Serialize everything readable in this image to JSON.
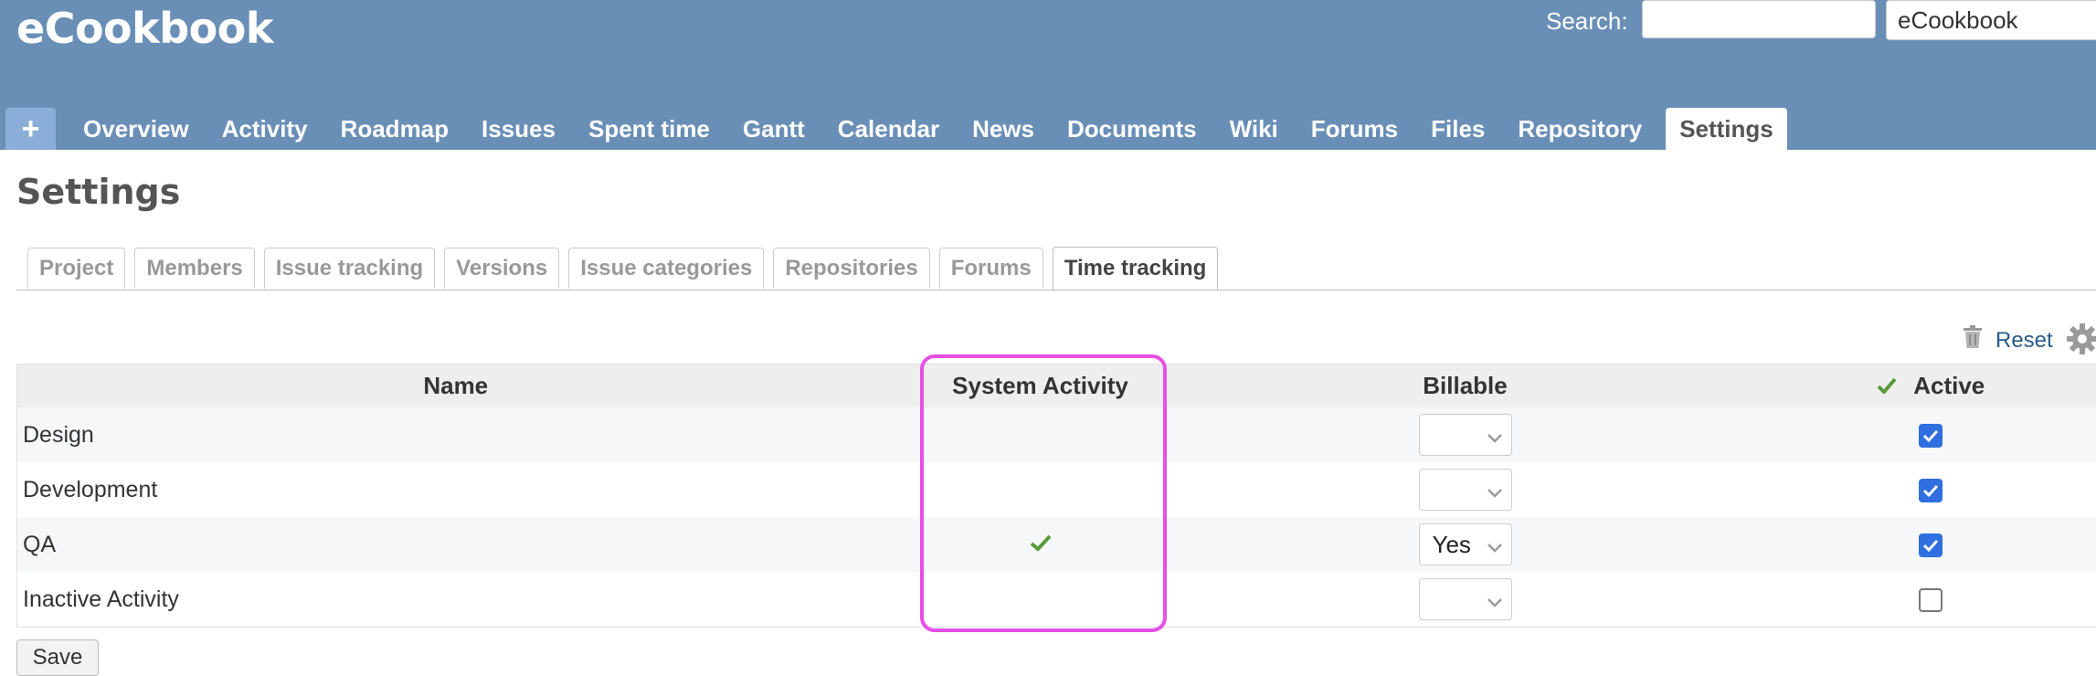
{
  "header": {
    "app_title": "eCookbook",
    "search_label": "Search:",
    "search_value": "",
    "project_select": "eCookbook"
  },
  "main_menu": {
    "plus_label": "+",
    "items": [
      {
        "label": "Overview"
      },
      {
        "label": "Activity"
      },
      {
        "label": "Roadmap"
      },
      {
        "label": "Issues"
      },
      {
        "label": "Spent time"
      },
      {
        "label": "Gantt"
      },
      {
        "label": "Calendar"
      },
      {
        "label": "News"
      },
      {
        "label": "Documents"
      },
      {
        "label": "Wiki"
      },
      {
        "label": "Forums"
      },
      {
        "label": "Files"
      },
      {
        "label": "Repository"
      },
      {
        "label": "Settings",
        "selected": true
      }
    ]
  },
  "page": {
    "title": "Settings"
  },
  "settings_tabs": [
    {
      "label": "Project"
    },
    {
      "label": "Members"
    },
    {
      "label": "Issue tracking"
    },
    {
      "label": "Versions"
    },
    {
      "label": "Issue categories"
    },
    {
      "label": "Repositories"
    },
    {
      "label": "Forums"
    },
    {
      "label": "Time tracking",
      "selected": true
    }
  ],
  "actions": {
    "reset_label": "Reset"
  },
  "table": {
    "headers": {
      "name": "Name",
      "system_activity": "System Activity",
      "billable": "Billable",
      "active": "Active"
    },
    "rows": [
      {
        "name": "Design",
        "system_activity": false,
        "billable": "",
        "active": true
      },
      {
        "name": "Development",
        "system_activity": false,
        "billable": "",
        "active": true
      },
      {
        "name": "QA",
        "system_activity": true,
        "billable": "Yes",
        "active": true
      },
      {
        "name": "Inactive Activity",
        "system_activity": false,
        "billable": "",
        "active": false
      }
    ]
  },
  "form": {
    "save_label": "Save"
  },
  "icons": {
    "check": "check-icon",
    "trash": "trash-icon",
    "gear": "gear-icon",
    "chevron": "chevron-down-icon"
  },
  "colors": {
    "header_bg": "#6a8fb7",
    "highlight": "#e64fe6",
    "checkbox": "#2f6fe0",
    "check_green": "#5a9a3a",
    "link": "#2a5a8a"
  }
}
